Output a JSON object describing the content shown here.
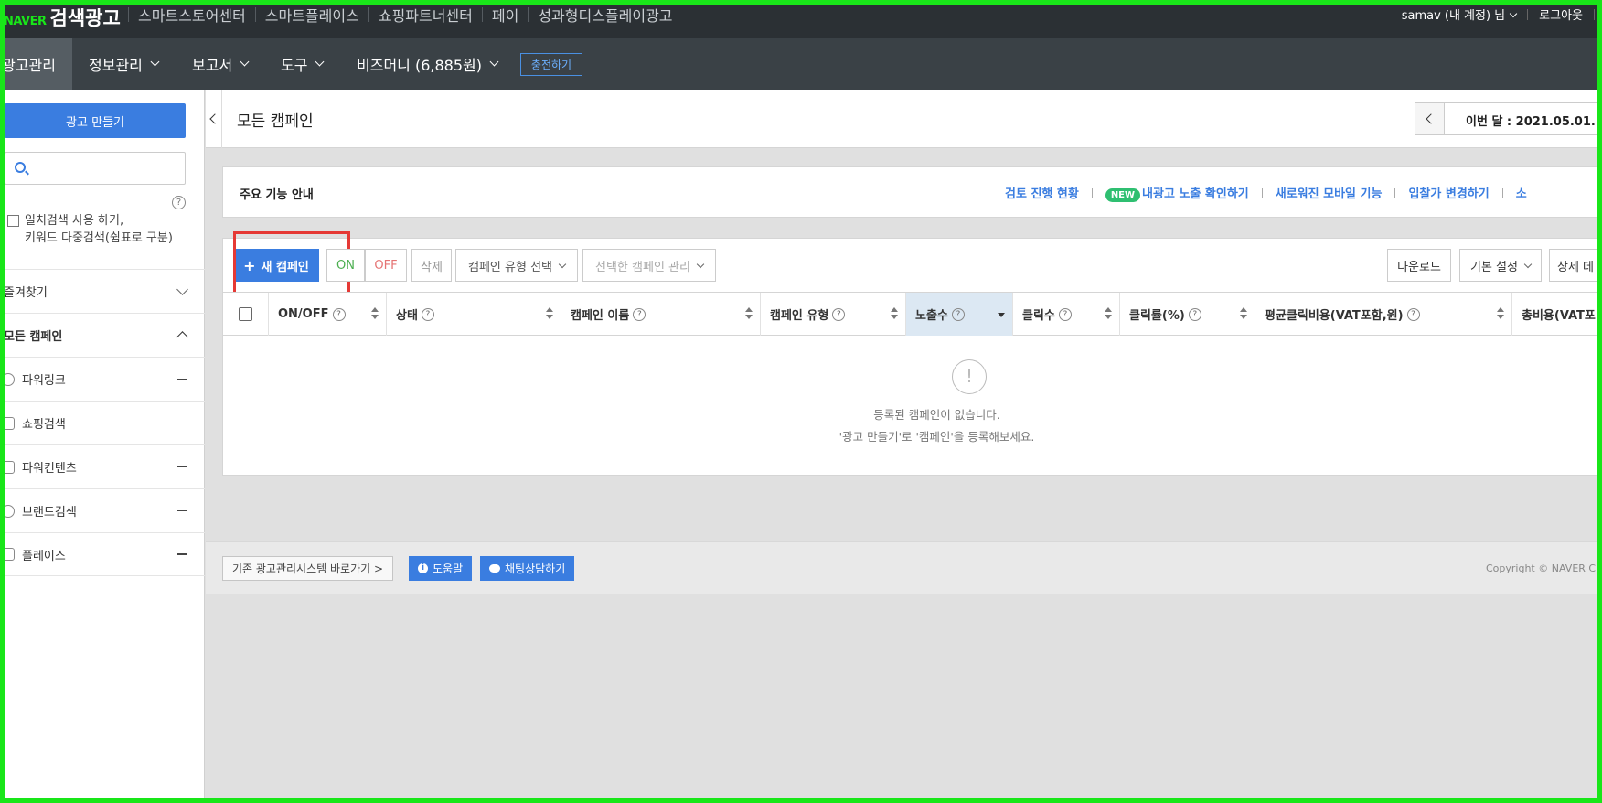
{
  "topbar": {
    "logo_naver": "NAVER",
    "logo_title": "검색광고",
    "nav": [
      "스마트스토어센터",
      "스마트플레이스",
      "쇼핑파트너센터",
      "페이",
      "성과형디스플레이광고"
    ],
    "user": "samav (내 계정) 님",
    "logout": "로그아웃"
  },
  "navbar": {
    "active": "광고관리",
    "items": [
      "정보관리",
      "보고서",
      "도구",
      "비즈머니 (6,885원)"
    ],
    "charge": "충전하기"
  },
  "sidebar": {
    "create_button": "광고 만들기",
    "search_placeholder": "",
    "help": "?",
    "exact_search_label": "일치검색 사용 하기,",
    "exact_search_hint": "키워드 다중검색(쉼표로 구분)",
    "favorites": "즐겨찾기",
    "all_campaigns": "모든 캠페인",
    "campaign_types": [
      "파워링크",
      "쇼핑검색",
      "파워컨텐츠",
      "브랜드검색",
      "플레이스"
    ]
  },
  "page": {
    "title": "모든 캠페인",
    "date_range": "이번 달 : 2021.05.01. ~"
  },
  "guide": {
    "label": "주요 기능 안내",
    "links": [
      "검토 진행 현황",
      "내광고 노출 확인하기",
      "새로워진 모바일 기능",
      "입찰가 변경하기",
      "소"
    ],
    "new_badge": "NEW"
  },
  "toolbar": {
    "new_campaign": "새 캠페인",
    "on": "ON",
    "off": "OFF",
    "delete": "삭제",
    "type_select": "캠페인 유형 선택",
    "manage_select": "선택한 캠페인 관리",
    "download": "다운로드",
    "default_settings": "기본 설정",
    "details": "상세 데"
  },
  "table": {
    "columns": [
      "ON/OFF",
      "상태",
      "캠페인 이름",
      "캠페인 유형",
      "노출수",
      "클릭수",
      "클릭률(%)",
      "평균클릭비용(VAT포함,원)",
      "총비용(VAT포"
    ],
    "empty_line1": "등록된 캠페인이 없습니다.",
    "empty_line2": "'광고 만들기'로 '캠페인'을 등록해보세요."
  },
  "footer": {
    "legacy": "기존 광고관리시스템 바로가기 >",
    "help": "도움말",
    "chat": "채팅상담하기",
    "copyright": "Copyright © NAVER C"
  },
  "colors": {
    "accent": "#3a7de0",
    "topbar": "#2b3034",
    "navbar": "#3a4146",
    "highlight": "#e53935",
    "frame": "#19e619"
  }
}
